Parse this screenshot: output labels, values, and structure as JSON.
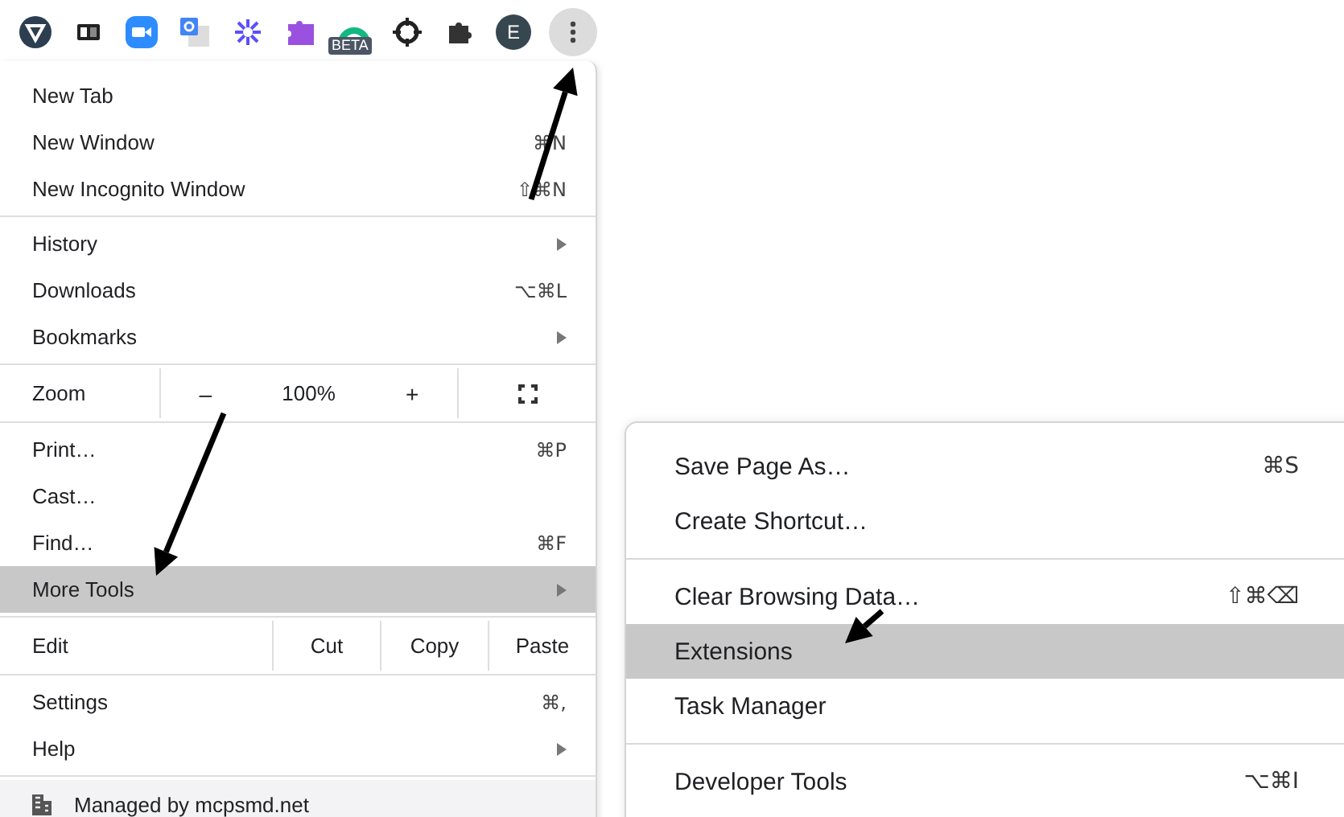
{
  "toolbar": {
    "beta_badge": "BETA",
    "avatar": "E"
  },
  "main_menu": {
    "sections": [
      [
        {
          "kind": "item",
          "label": "New Tab",
          "submenu": false,
          "selected": false
        },
        {
          "kind": "item",
          "label": "New Window",
          "shortcut": "⌘N",
          "submenu": false,
          "selected": false
        },
        {
          "kind": "item",
          "label": "New Incognito Window",
          "shortcut": "⇧⌘N",
          "submenu": false,
          "selected": false
        }
      ],
      [
        {
          "kind": "item",
          "label": "History",
          "submenu": true,
          "selected": false
        },
        {
          "kind": "item",
          "label": "Downloads",
          "shortcut": "⌥⌘L",
          "submenu": false,
          "selected": false
        },
        {
          "kind": "item",
          "label": "Bookmarks",
          "submenu": true,
          "selected": false
        }
      ],
      [
        {
          "kind": "zoom",
          "label": "Zoom",
          "minus": "–",
          "value": "100%",
          "plus": "+"
        }
      ],
      [
        {
          "kind": "item",
          "label": "Print…",
          "shortcut": "⌘P",
          "submenu": false,
          "selected": false
        },
        {
          "kind": "item",
          "label": "Cast…",
          "submenu": false,
          "selected": false
        },
        {
          "kind": "item",
          "label": "Find…",
          "shortcut": "⌘F",
          "submenu": false,
          "selected": false
        },
        {
          "kind": "item",
          "label": "More Tools",
          "submenu": true,
          "selected": true
        }
      ],
      [
        {
          "kind": "edit",
          "label": "Edit",
          "buttons": [
            "Cut",
            "Copy",
            "Paste"
          ]
        }
      ],
      [
        {
          "kind": "item",
          "label": "Settings",
          "shortcut": "⌘,",
          "submenu": false,
          "selected": false
        },
        {
          "kind": "item",
          "label": "Help",
          "submenu": true,
          "selected": false
        }
      ],
      [
        {
          "kind": "managed",
          "label": "Managed by mcpsmd.net"
        }
      ]
    ]
  },
  "more_tools_menu": {
    "sections": [
      [
        {
          "label": "Save Page As…",
          "shortcut": "⌘S",
          "selected": false
        },
        {
          "label": "Create Shortcut…",
          "selected": false
        }
      ],
      [
        {
          "label": "Clear Browsing Data…",
          "shortcut": "⇧⌘⌫",
          "selected": false
        },
        {
          "label": "Extensions",
          "selected": true
        },
        {
          "label": "Task Manager",
          "selected": false
        }
      ],
      [
        {
          "label": "Developer Tools",
          "shortcut": "⌥⌘I",
          "selected": false
        }
      ]
    ]
  }
}
